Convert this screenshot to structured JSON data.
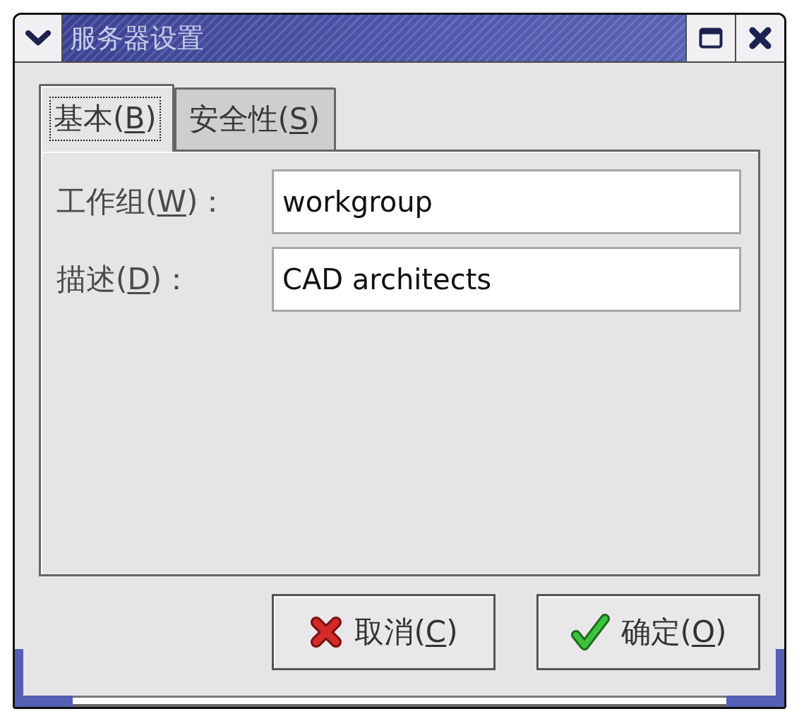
{
  "window": {
    "title": "服务器设置"
  },
  "tabs": [
    {
      "label": {
        "before": "基本(",
        "key": "B",
        "after": ")"
      },
      "selected": true,
      "focused": true
    },
    {
      "label": {
        "before": "安全性(",
        "key": "S",
        "after": ")"
      },
      "selected": false,
      "focused": false
    }
  ],
  "fields": [
    {
      "label": {
        "before": "工作组(",
        "key": "W",
        "after": ")："
      },
      "value": "workgroup"
    },
    {
      "label": {
        "before": "描述(",
        "key": "D",
        "after": ")："
      },
      "value": "CAD architects"
    }
  ],
  "buttons": [
    {
      "kind": "cancel",
      "label": {
        "before": "取消(",
        "key": "C",
        "after": ")"
      }
    },
    {
      "kind": "ok",
      "label": {
        "before": "确定(",
        "key": "O",
        "after": ")"
      }
    }
  ]
}
